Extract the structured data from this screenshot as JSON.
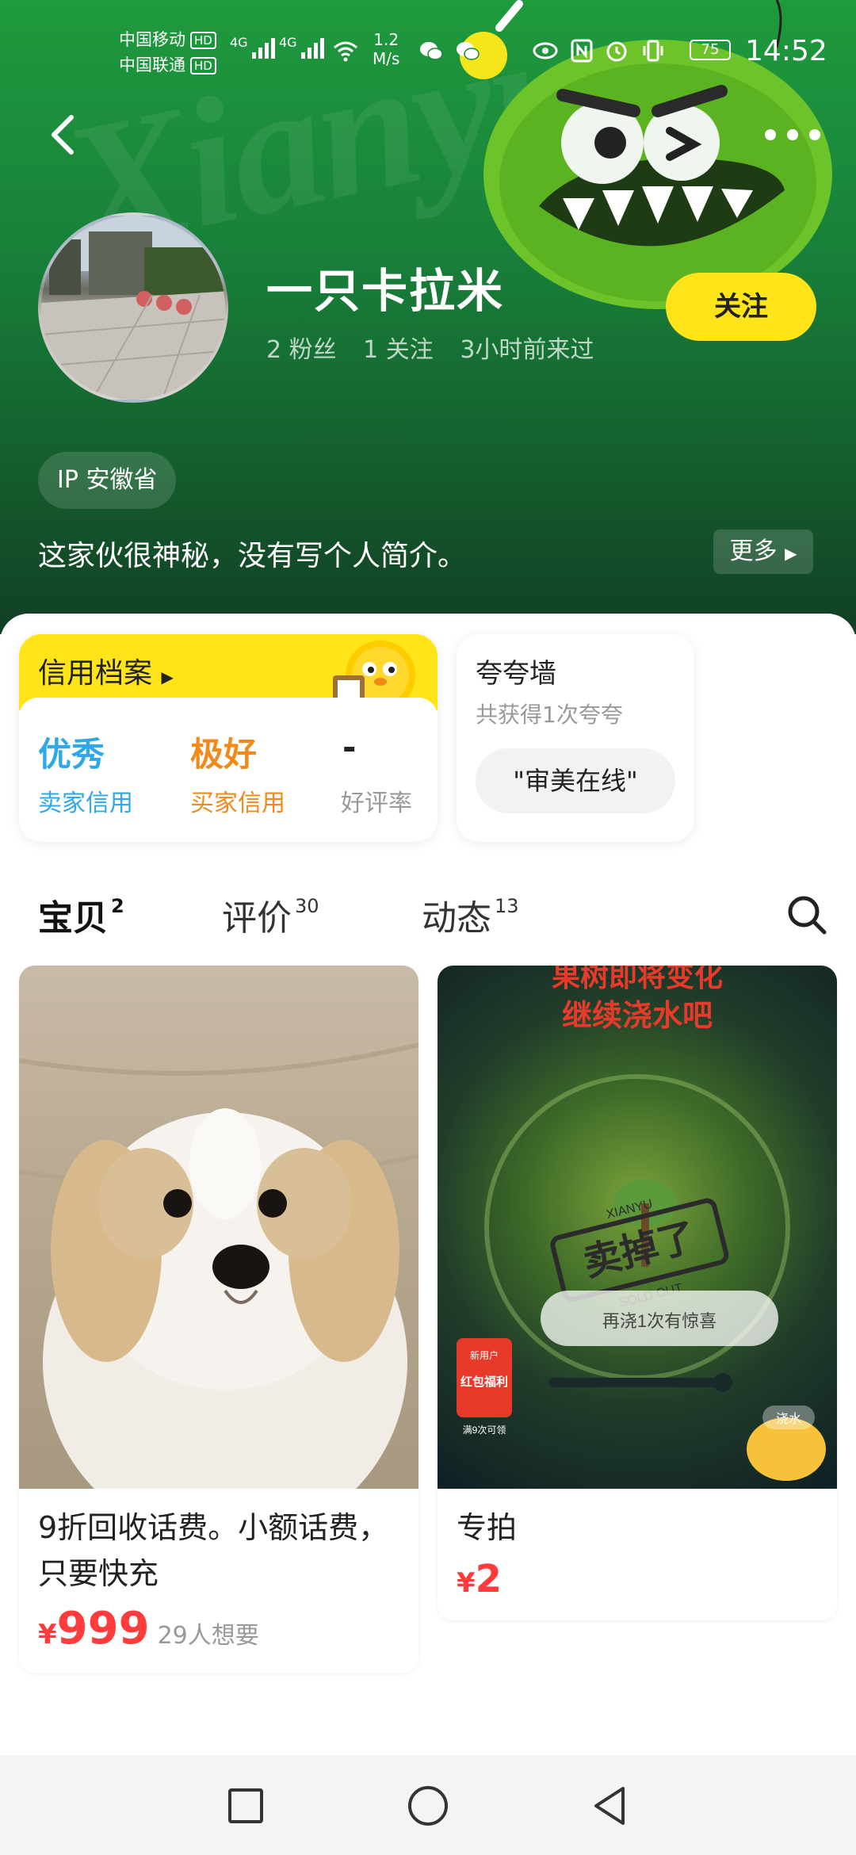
{
  "status_bar": {
    "carrier1": "中国移动",
    "carrier2": "中国联通",
    "hd": "HD",
    "net1": "4G",
    "net2": "4G",
    "speed_value": "1.2",
    "speed_unit": "M/s",
    "battery": "75",
    "time": "14:52"
  },
  "header": {
    "watermark": "Xianyu",
    "nickname": "一只卡拉米",
    "stats": [
      "2 粉丝",
      "1 关注",
      "3小时前来过"
    ],
    "follow_label": "关注",
    "ip_label": "IP 安徽省",
    "bio": "这家伙很神秘，没有写个人简介。",
    "more_label": "更多"
  },
  "credit": {
    "title": "信用档案",
    "items": [
      {
        "value": "优秀",
        "label": "卖家信用",
        "color": "#2fa8e8"
      },
      {
        "value": "极好",
        "label": "买家信用",
        "color": "#f08a1c"
      },
      {
        "value": "-",
        "label": "好评率",
        "color": "#222222"
      }
    ]
  },
  "praise": {
    "title": "夸夸墙",
    "subtitle": "共获得1次夸夸",
    "chip": "\"审美在线\""
  },
  "tabs": [
    {
      "label": "宝贝",
      "count": "2"
    },
    {
      "label": "评价",
      "count": "30"
    },
    {
      "label": "动态",
      "count": "13"
    }
  ],
  "products": [
    {
      "title": "9折回收话费。小额话费，只要快充",
      "price_symbol": "¥",
      "price": "999",
      "want": "29人想要"
    },
    {
      "title": "专拍",
      "price_symbol": "¥",
      "price": "2",
      "want": ""
    }
  ],
  "game_image": {
    "banner": "果树即将变化",
    "banner2": "继续浇水吧",
    "stamp": "卖掉了",
    "stamp_top": "XIANYU",
    "stamp_bottom": "SOLD OUT",
    "bubble": "再浇1次有惊喜",
    "badge_top": "新用户",
    "badge_mid": "红包福利",
    "badge_bottom": "满9次可领",
    "water": "浇水"
  },
  "colors": {
    "accent_yellow": "#ffe41a",
    "header_green": "#1f9a3d",
    "price_red": "#ff3b3b"
  }
}
